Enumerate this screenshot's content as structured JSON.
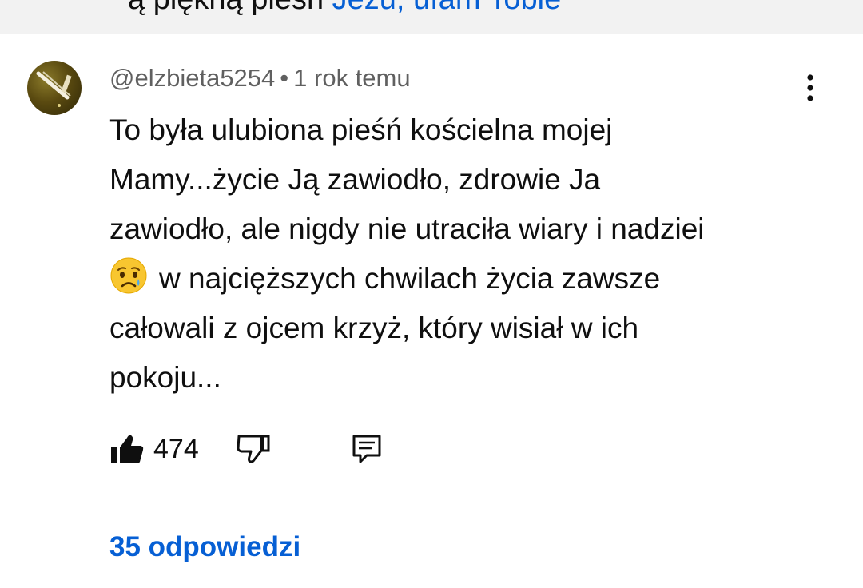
{
  "top_band": {
    "text": "ą piękną pieśń ",
    "link_text": "Jezu, ufam Tobie"
  },
  "comment": {
    "author": "@elzbieta5254",
    "separator": "•",
    "timestamp": "1 rok temu",
    "lines": [
      "To była ulubiona pieśń kościelna mojej",
      "Mamy...życie Ją zawiodło, zdrowie Ja",
      "zawiodło, ale nigdy nie utraciła wiary i nadziei",
      "w najcięższych chwilach życia zawsze",
      "całowali z ojcem krzyż, który wisiał w ich",
      "pokoju..."
    ],
    "emoji_icon": "sad-relieved-face-emoji",
    "like_count": "474"
  },
  "replies": {
    "label": "35 odpowiedzi"
  },
  "colors": {
    "link": "#065fd4",
    "meta_text": "#606060",
    "body_text": "#0f0f0f",
    "top_band_bg": "#f2f2f2"
  }
}
